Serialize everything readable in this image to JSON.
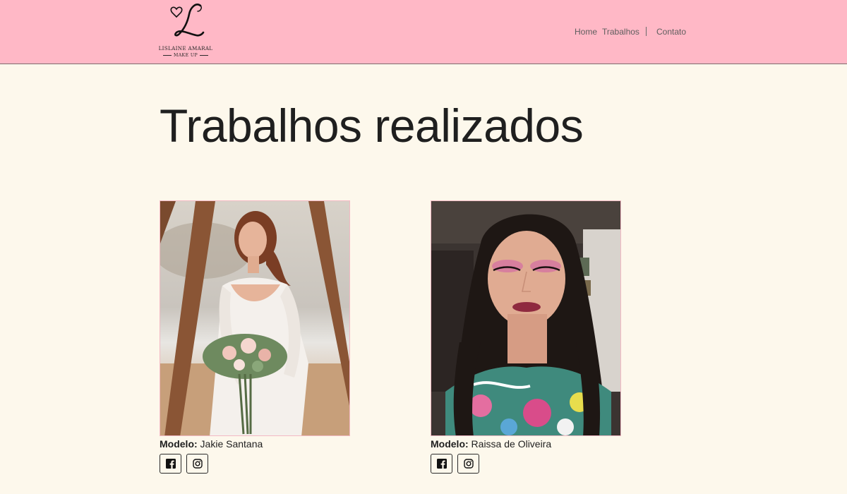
{
  "brand": {
    "logo_letter": "L",
    "name": "LISLAINE AMARAL",
    "tagline": "MAKE UP"
  },
  "nav": {
    "home": "Home",
    "trabalhos": "Trabalhos",
    "contato": "Contato"
  },
  "page": {
    "title": "Trabalhos realizados"
  },
  "works": [
    {
      "model_label": "Modelo:",
      "model_name": "Jakie Santana",
      "photo_icon": "bride-photo",
      "socials": [
        "facebook-icon",
        "instagram-icon"
      ]
    },
    {
      "model_label": "Modelo:",
      "model_name": "Raissa de Oliveira",
      "photo_icon": "makeup-portrait-photo",
      "socials": [
        "facebook-icon",
        "instagram-icon"
      ]
    }
  ],
  "colors": {
    "navbar": "#ffb8c6",
    "background": "#fdf8ec",
    "photo_border": "#f3b9c4",
    "text": "#1f1f1f"
  }
}
